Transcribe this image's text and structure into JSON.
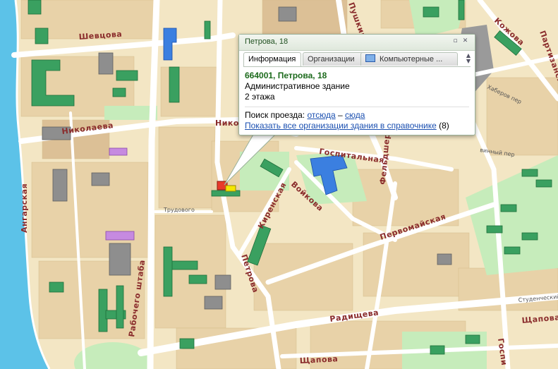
{
  "map": {
    "colors": {
      "land": "#f3e6c4",
      "block": "#e8d2a8",
      "brick": "#dcc096",
      "park": "#c6ecbb",
      "water": "#5cc2e8",
      "road": "#ffffff",
      "building": "#3aa060",
      "building_dark": "#8e8e8e",
      "label": "#8a2c2c"
    },
    "streets": {
      "shevtsova": "Шевцова",
      "nikolaeva": "Николаева",
      "nikolaeva_2": "Никол",
      "angarskaya": "Ангарская",
      "rabochego_shtaba": "Рабочего штаба",
      "kirenskaya": "Киренская",
      "voykova": "Войкова",
      "gospitalnaya": "Госпитальная",
      "feldshersky": "Фельдшер",
      "pervomayskaya": "Первомайская",
      "petrova": "Петрова",
      "radishcheva": "Радищева",
      "shchapova": "Щапова",
      "shchapova_2": "Щапова",
      "pushkina": "Пушкина",
      "kozhova": "Кожова",
      "partizanskaya": "Партизанская",
      "gospitalny": "Госпи",
      "trudovoy": "Трудового",
      "hbarovsky": "Хаберов пер",
      "studencheskiy": "Студенческий пер",
      "vinny": "винный пер"
    }
  },
  "popup": {
    "title": "Петрова, 18",
    "tabs": [
      {
        "label": "Информация",
        "active": true
      },
      {
        "label": "Организации",
        "active": false
      },
      {
        "label": "Компьютерные ...",
        "active": false
      }
    ],
    "address": "664001, Петрова, 18",
    "building_type": "Административное здание",
    "floors": "2 этажа",
    "route_label": "Поиск проезда:",
    "route_from": "отсюда",
    "route_dash": "–",
    "route_to": "сюда",
    "show_all_link": "Показать все организации здания в справочнике",
    "org_count": "(8)"
  }
}
